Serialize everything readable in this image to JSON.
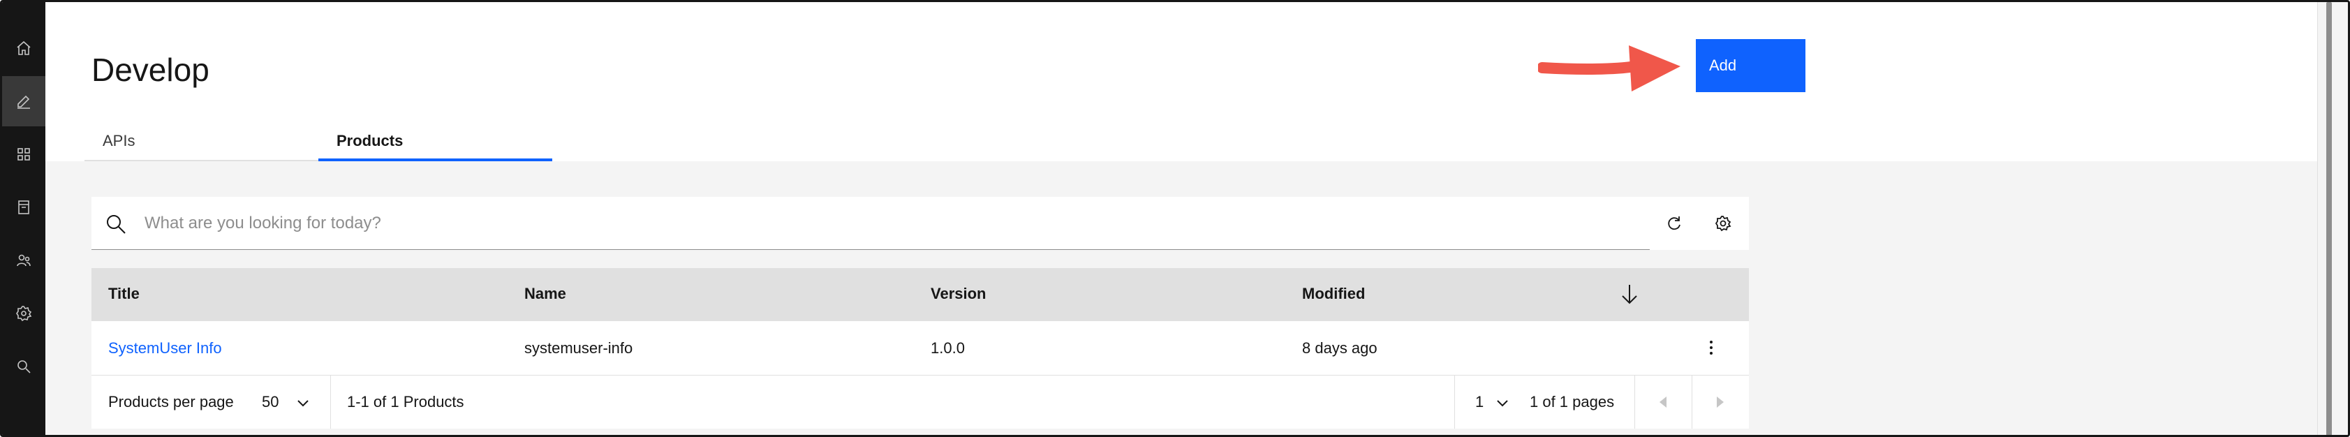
{
  "rail": {
    "items": [
      {
        "icon": "home-icon"
      },
      {
        "icon": "develop-edit-icon",
        "active": true
      },
      {
        "icon": "apps-grid-icon"
      },
      {
        "icon": "catalog-icon"
      },
      {
        "icon": "members-icon"
      },
      {
        "icon": "settings-gear-icon"
      },
      {
        "icon": "search-icon"
      }
    ]
  },
  "header": {
    "title": "Develop",
    "add_label": "Add",
    "tabs": [
      {
        "label": "APIs",
        "selected": false
      },
      {
        "label": "Products",
        "selected": true
      }
    ]
  },
  "search": {
    "placeholder": "What are you looking for today?",
    "value": ""
  },
  "table": {
    "columns": [
      "Title",
      "Name",
      "Version",
      "Modified"
    ],
    "rows": [
      {
        "title": "SystemUser Info",
        "name": "systemuser-info",
        "version": "1.0.0",
        "modified": "8 days ago"
      }
    ]
  },
  "pager": {
    "per_page_label": "Products per page",
    "per_page_value": "50",
    "range_text": "1-1 of 1 Products",
    "page_value": "1",
    "pages_text": "1 of 1 pages"
  },
  "colors": {
    "accent": "#0f62fe",
    "arrow": "#f0574a",
    "rail": "#161616"
  }
}
